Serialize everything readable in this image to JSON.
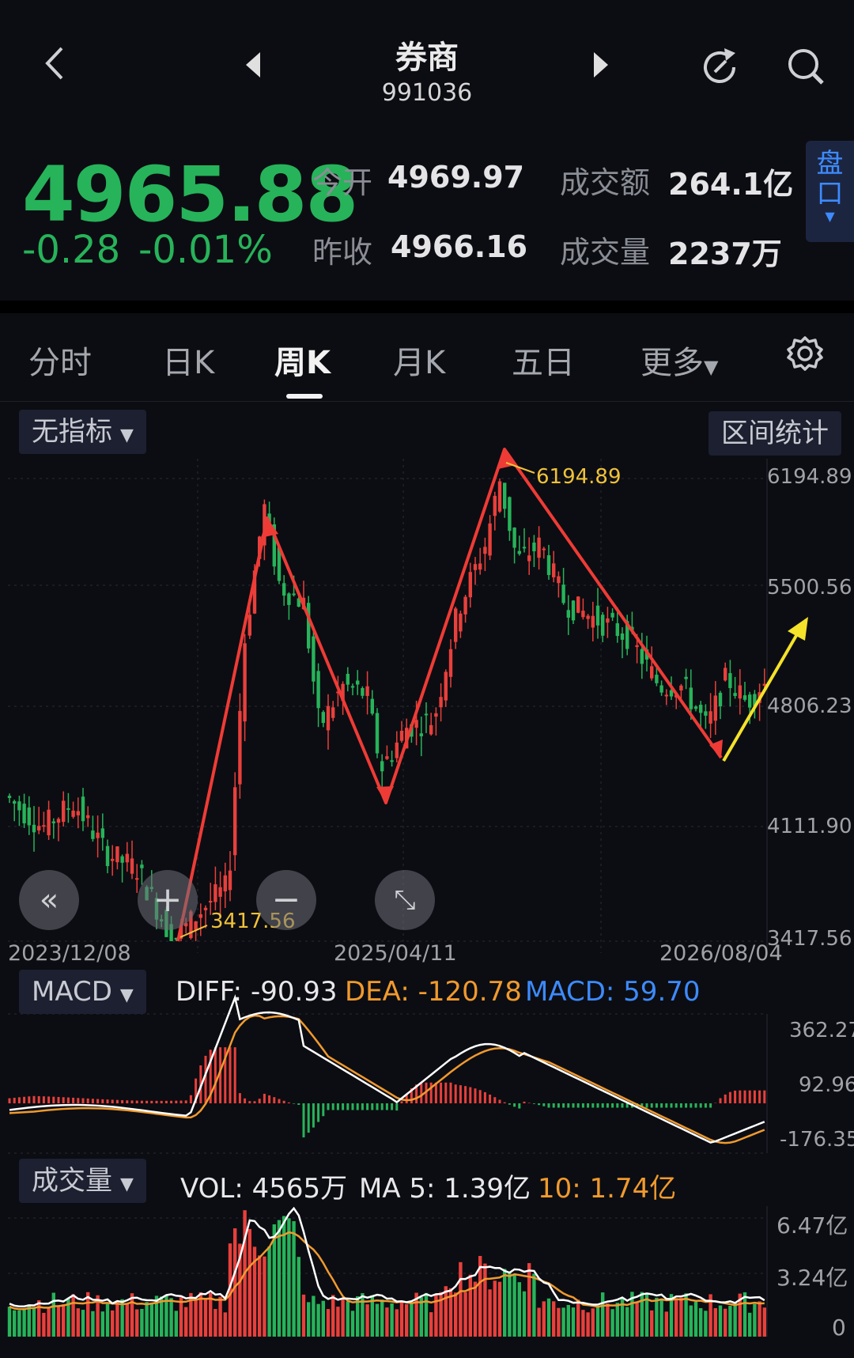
{
  "header": {
    "title": "券商",
    "code": "991036"
  },
  "quote": {
    "price": "4965.88",
    "change": "-0.28",
    "change_pct": "-0.01%",
    "open_label": "今开",
    "open_value": "4969.97",
    "prev_close_label": "昨收",
    "prev_close_value": "4966.16",
    "turnover_label": "成交额",
    "turnover_value": "264.1亿",
    "volume_label": "成交量",
    "volume_value": "2237万",
    "pankou_label": "盘口",
    "up_color": "#e8403c",
    "down_color": "#27b35a"
  },
  "tabs": [
    {
      "label": "分时"
    },
    {
      "label": "日K"
    },
    {
      "label": "周K"
    },
    {
      "label": "月K"
    },
    {
      "label": "五日"
    },
    {
      "label": "更多"
    }
  ],
  "main_chart": {
    "indicator_label": "无指标",
    "range_stat_label": "区间统计",
    "y_ticks": [
      "6194.89",
      "5500.56",
      "4806.23",
      "4111.90",
      "3417.56"
    ],
    "high_marker": "6194.89",
    "low_marker": "3417.56",
    "dates": [
      "2023/12/08",
      "2025/04/11",
      "2026/08/04"
    ]
  },
  "macd": {
    "label": "MACD",
    "diff": "DIFF: -90.93",
    "dea": "DEA: -120.78",
    "macd": "MACD: 59.70",
    "y_ticks": [
      "362.27",
      "92.96",
      "-176.35"
    ]
  },
  "volume": {
    "label": "成交量",
    "vol": "VOL: 4565万",
    "ma5": "MA 5: 1.39亿",
    "ma10": "10: 1.74亿",
    "y_ticks": [
      "6.47亿",
      "3.24亿",
      "0"
    ]
  },
  "chart_data": {
    "type": "candlestick",
    "period": "weekly",
    "price_range": [
      3417.56,
      6194.89
    ],
    "high": 6194.89,
    "low": 3417.56,
    "x_labels": [
      "2023/12/08",
      "2025/04/11",
      "2026/08/04"
    ],
    "macd_range": [
      -176.35,
      362.27
    ],
    "volume_range_yi": [
      0,
      6.47
    ]
  }
}
